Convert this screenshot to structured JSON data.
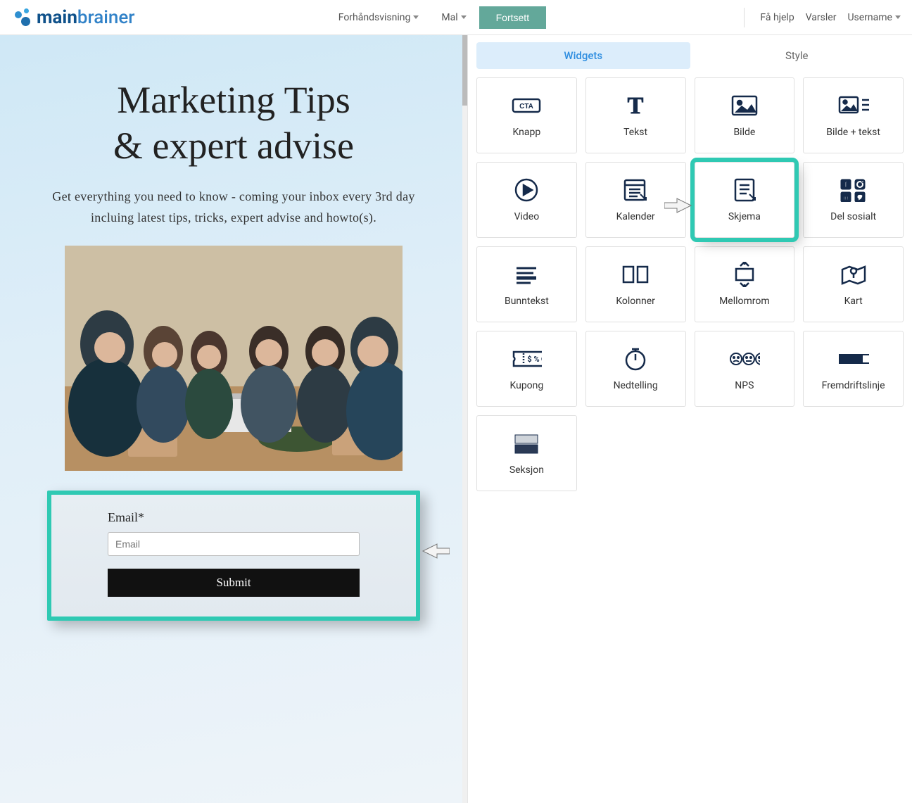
{
  "brand": {
    "part1": "main",
    "part2": "brainer"
  },
  "topnav": {
    "preview": "Forhåndsvisning",
    "template": "Mal",
    "continue": "Fortsett"
  },
  "usernav": {
    "help": "Få hjelp",
    "alerts": "Varsler",
    "username": "Username"
  },
  "canvas": {
    "headline_line1": "Marketing Tips",
    "headline_line2": "& expert advise",
    "subhead": "Get everything you need to know - coming your inbox every 3rd day incluing latest tips, tricks, expert advise and howto(s).",
    "form": {
      "label": "Email*",
      "placeholder": "Email",
      "submit": "Submit"
    }
  },
  "sidebar": {
    "tab_widgets": "Widgets",
    "tab_style": "Style",
    "widgets": [
      {
        "id": "knapp",
        "label": "Knapp"
      },
      {
        "id": "tekst",
        "label": "Tekst"
      },
      {
        "id": "bilde",
        "label": "Bilde"
      },
      {
        "id": "bilde-tekst",
        "label": "Bilde + tekst"
      },
      {
        "id": "video",
        "label": "Video"
      },
      {
        "id": "kalender",
        "label": "Kalender"
      },
      {
        "id": "skjema",
        "label": "Skjema",
        "highlighted": true
      },
      {
        "id": "del-sosialt",
        "label": "Del sosialt"
      },
      {
        "id": "bunntekst",
        "label": "Bunntekst"
      },
      {
        "id": "kolonner",
        "label": "Kolonner"
      },
      {
        "id": "mellomrom",
        "label": "Mellomrom"
      },
      {
        "id": "kart",
        "label": "Kart"
      },
      {
        "id": "kupong",
        "label": "Kupong"
      },
      {
        "id": "nedtelling",
        "label": "Nedtelling"
      },
      {
        "id": "nps",
        "label": "NPS"
      },
      {
        "id": "fremdrift",
        "label": "Fremdriftslinje"
      },
      {
        "id": "seksjon",
        "label": "Seksjon"
      }
    ]
  }
}
